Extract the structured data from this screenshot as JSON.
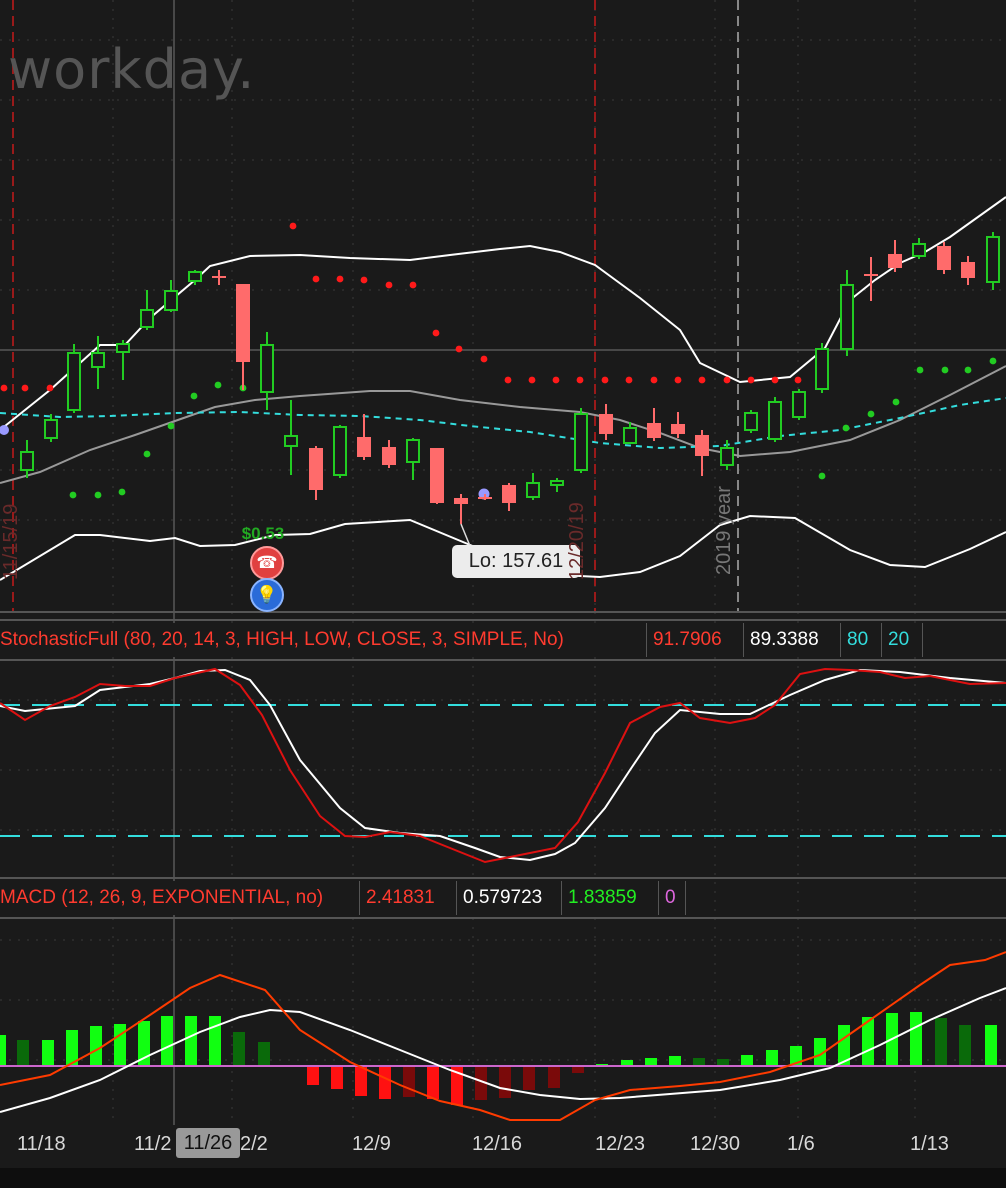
{
  "watermark": "workday.",
  "price_panel": {
    "earnings_label": "$0.53",
    "low_tooltip": "Lo: 157.61",
    "divider_labels": {
      "expiry_left": "11/15/19",
      "expiry_right": "12/20/19",
      "year": "2019 year"
    },
    "icons": [
      "phone-icon",
      "lightbulb-icon"
    ]
  },
  "stochastic": {
    "name": "StochasticFull (80, 20, 14, 3, HIGH, LOW, CLOSE, 3, SIMPLE, No)",
    "values": [
      "91.7906",
      "89.3388",
      "80",
      "20"
    ],
    "value_colors": [
      "#ff3b2f",
      "#ffffff",
      "#33dddd",
      "#33dddd"
    ],
    "overbought": 80,
    "oversold": 20
  },
  "macd": {
    "name": "MACD (12, 26, 9, EXPONENTIAL, no)",
    "values": [
      "2.41831",
      "0.579723",
      "1.83859",
      "0"
    ],
    "value_colors": [
      "#ff3b2f",
      "#ffffff",
      "#22ee22",
      "#dd66dd"
    ]
  },
  "x_axis": {
    "labels": [
      "11/18",
      "11/2",
      "2/2",
      "12/9",
      "12/16",
      "12/23",
      "12/30",
      "1/6",
      "1/13"
    ],
    "cursor_label": "11/26"
  },
  "colors": {
    "up": "#22cc22",
    "down": "#ff6b6b",
    "bollinger": "#ffffff",
    "middle": "#999999",
    "ema_dashed": "#33dddd",
    "sar_red": "#ff1a1a",
    "sar_green": "#22cc22",
    "macd_value": "#ff3b00",
    "macd_avg": "#ffffff",
    "hist_pos_strong": "#11ff11",
    "hist_pos_weak": "#0a6a0a",
    "hist_neg_strong": "#ff1111",
    "hist_neg_weak": "#7a0a0a",
    "zero_line": "#cc66cc"
  },
  "chart_data": {
    "type": "candlestick",
    "x": [
      "11/18",
      "11/26",
      "12/2",
      "12/9",
      "12/16",
      "12/23",
      "12/30",
      "1/6",
      "1/13"
    ],
    "price_low_marker": 157.61,
    "stochastic_levels": [
      80,
      20
    ],
    "macd_histogram_sign": [
      "+",
      "+",
      "+",
      "+",
      "+",
      "+",
      "+",
      "+",
      "-",
      "-",
      "-",
      "-",
      "-",
      "-",
      "-",
      "-",
      "-",
      "-",
      "-",
      "-",
      "+",
      "+",
      "+",
      "+",
      "+",
      "+",
      "+",
      "+",
      "+",
      "+",
      "+",
      "+",
      "+",
      "+",
      "+",
      "+"
    ]
  }
}
